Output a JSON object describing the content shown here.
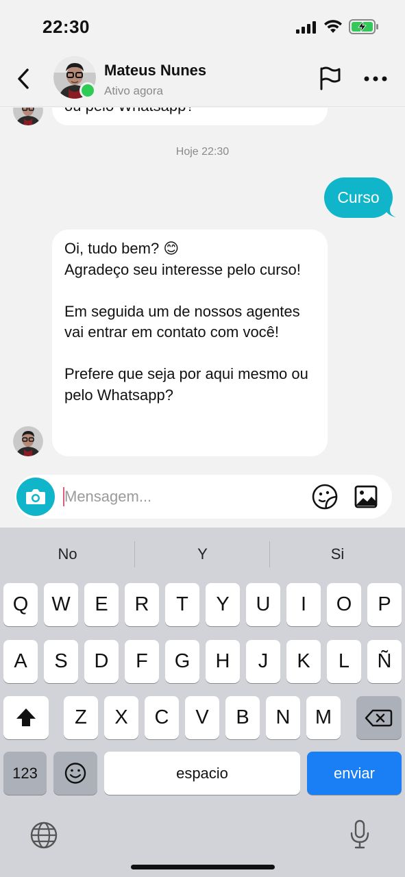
{
  "status_bar": {
    "time": "22:30"
  },
  "header": {
    "contact_name": "Mateus Nunes",
    "contact_status": "Ativo agora"
  },
  "chat": {
    "previous_message_fragment": "ou pelo Whatsapp?",
    "date_separator": "Hoje 22:30",
    "sent_message": "Curso",
    "received_message": "Oi, tudo bem? 😊\nAgradeço seu interesse pelo curso!\n\nEm seguida um de nossos agentes vai entrar em contato com você!\n\nPrefere que seja por aqui mesmo ou pelo Whatsapp?"
  },
  "composer": {
    "placeholder": "Mensagem...",
    "value": ""
  },
  "keyboard": {
    "suggestions": [
      "No",
      "Y",
      "Si"
    ],
    "row1": [
      "Q",
      "W",
      "E",
      "R",
      "T",
      "Y",
      "U",
      "I",
      "O",
      "P"
    ],
    "row2": [
      "A",
      "S",
      "D",
      "F",
      "G",
      "H",
      "J",
      "K",
      "L",
      "Ñ"
    ],
    "row3": [
      "Z",
      "X",
      "C",
      "V",
      "B",
      "N",
      "M"
    ],
    "numbers_label": "123",
    "space_label": "espacio",
    "send_label": "enviar"
  },
  "colors": {
    "accent": "#10b5c9",
    "online": "#2ecc55",
    "send_key": "#1a7ff5",
    "battery_charging": "#34c759"
  },
  "icons": [
    "back-arrow",
    "flag",
    "more-dots",
    "camera",
    "sticker",
    "image",
    "shift",
    "backspace",
    "emoji",
    "globe",
    "microphone"
  ]
}
